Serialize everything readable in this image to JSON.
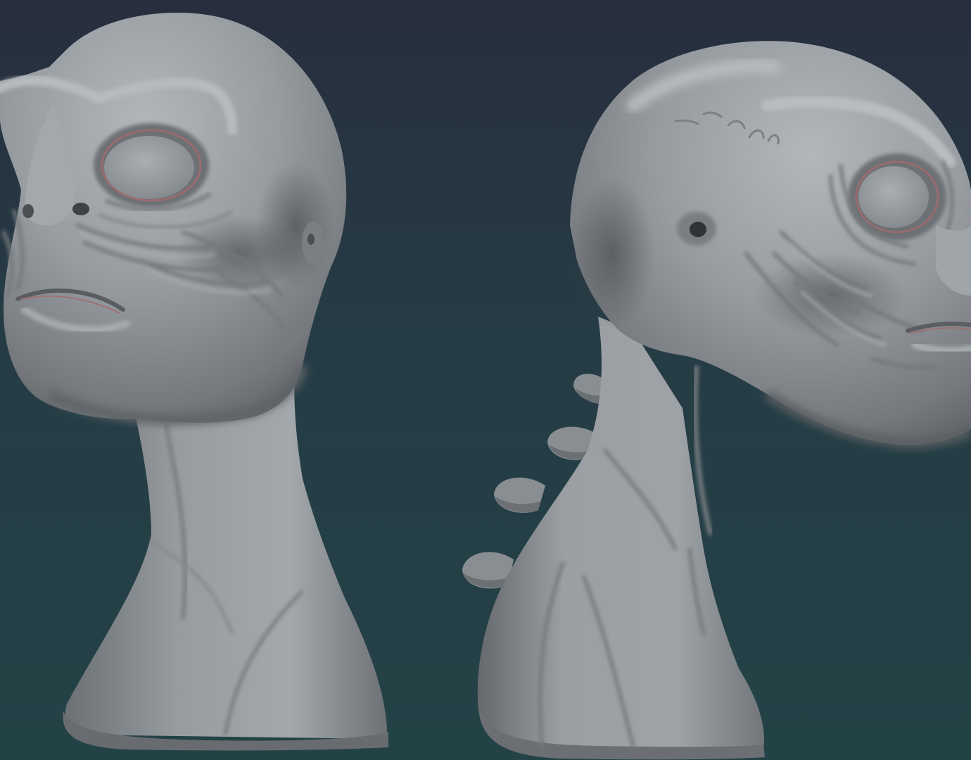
{
  "scene": {
    "background": {
      "top": "#272e3e",
      "middle": "#263c45",
      "bottom": "#234246"
    },
    "clay": {
      "light": "#a8adb1",
      "mid": "#8d9296",
      "shadow": "#5f6468",
      "deep": "#3e4246",
      "crease": "#a26a6e"
    },
    "sculptures": [
      {
        "name": "bust-front-three-quarter-view",
        "facing": "left"
      },
      {
        "name": "bust-side-three-quarter-view",
        "facing": "right"
      }
    ]
  }
}
